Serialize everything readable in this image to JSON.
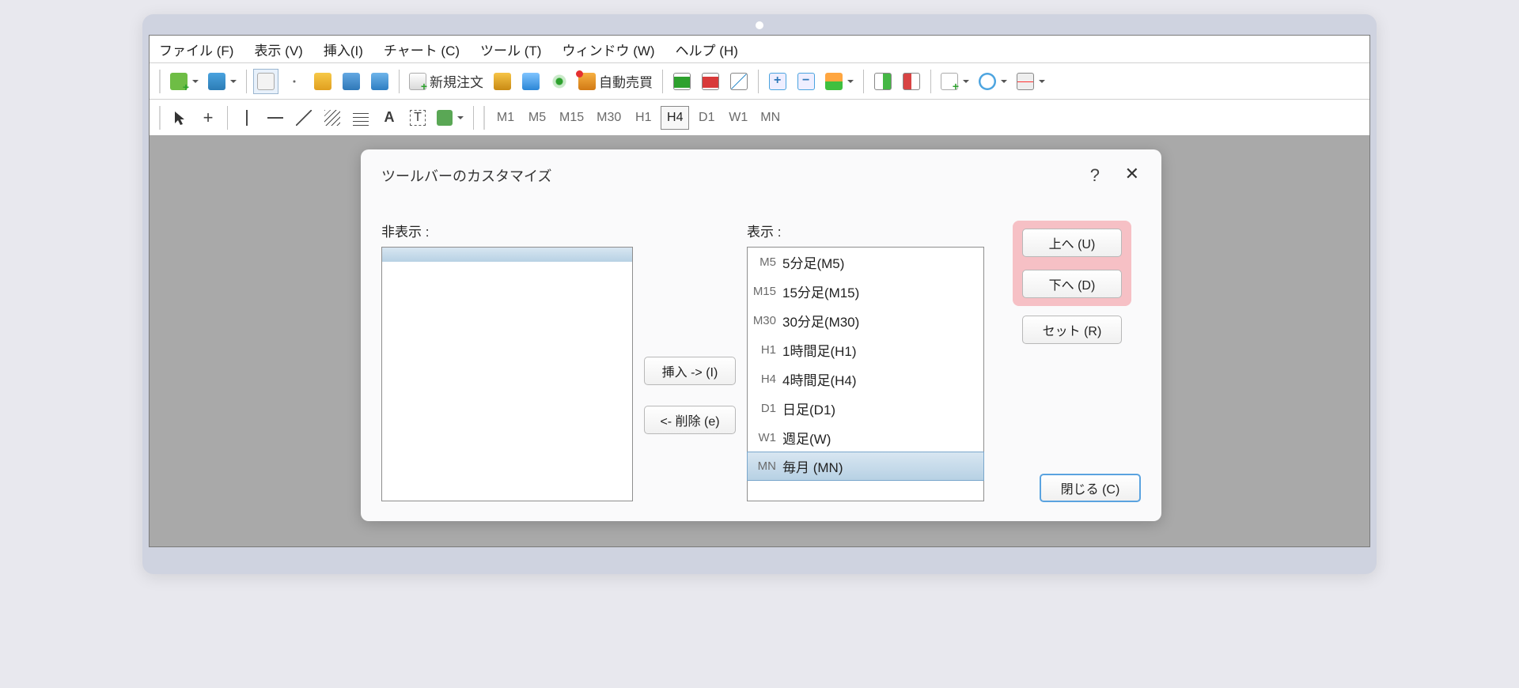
{
  "menubar": [
    "ファイル (F)",
    "表示 (V)",
    "挿入(I)",
    "チャート (C)",
    "ツール (T)",
    "ウィンドウ (W)",
    "ヘルプ (H)"
  ],
  "toolbar1": {
    "new_order": "新規注文",
    "auto_trade": "自動売買"
  },
  "toolbar2": {
    "periods": [
      "M1",
      "M5",
      "M15",
      "M30",
      "H1",
      "H4",
      "D1",
      "W1",
      "MN"
    ],
    "selected_period": "H4"
  },
  "dialog": {
    "title": "ツールバーのカスタマイズ",
    "help": "?",
    "close": "✕",
    "left_label": "非表示 :",
    "right_label": "表示 :",
    "insert_btn": "挿入 -> (I)",
    "remove_btn": "<- 削除 (e)",
    "up_btn": "上へ (U)",
    "down_btn": "下へ (D)",
    "set_btn": "セット (R)",
    "close_btn": "閉じる (C)",
    "right_list": [
      {
        "code": "M5",
        "label": "5分足(M5)"
      },
      {
        "code": "M15",
        "label": "15分足(M15)"
      },
      {
        "code": "M30",
        "label": "30分足(M30)"
      },
      {
        "code": "H1",
        "label": "1時間足(H1)"
      },
      {
        "code": "H4",
        "label": "4時間足(H4)"
      },
      {
        "code": "D1",
        "label": "日足(D1)"
      },
      {
        "code": "W1",
        "label": "週足(W)"
      },
      {
        "code": "MN",
        "label": "毎月 (MN)"
      }
    ],
    "right_selected": "MN"
  }
}
